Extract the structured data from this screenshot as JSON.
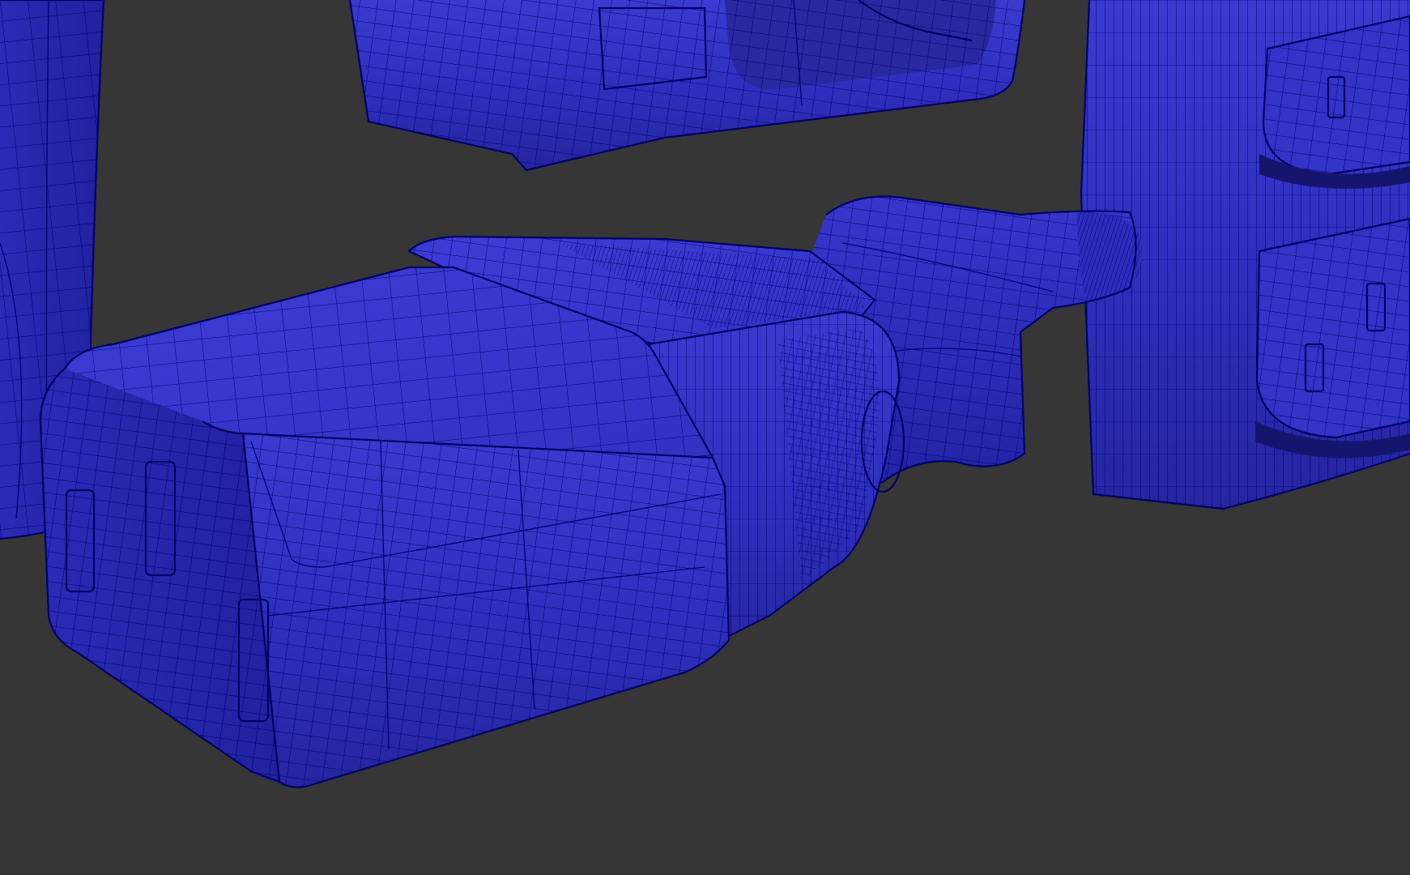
{
  "viewport": {
    "background": "#363636",
    "shading": "wireframe-on-shaded",
    "mesh_color": "#2f2fc0",
    "wire_color": "#00007a"
  },
  "objects": [
    {
      "id": "iec-c13-plug",
      "icon": "connector-plug-mesh"
    },
    {
      "id": "top-housing",
      "icon": "housing-mesh"
    },
    {
      "id": "right-socket-panel",
      "icon": "socket-panel-mesh"
    },
    {
      "id": "left-panel",
      "icon": "panel-mesh"
    }
  ]
}
